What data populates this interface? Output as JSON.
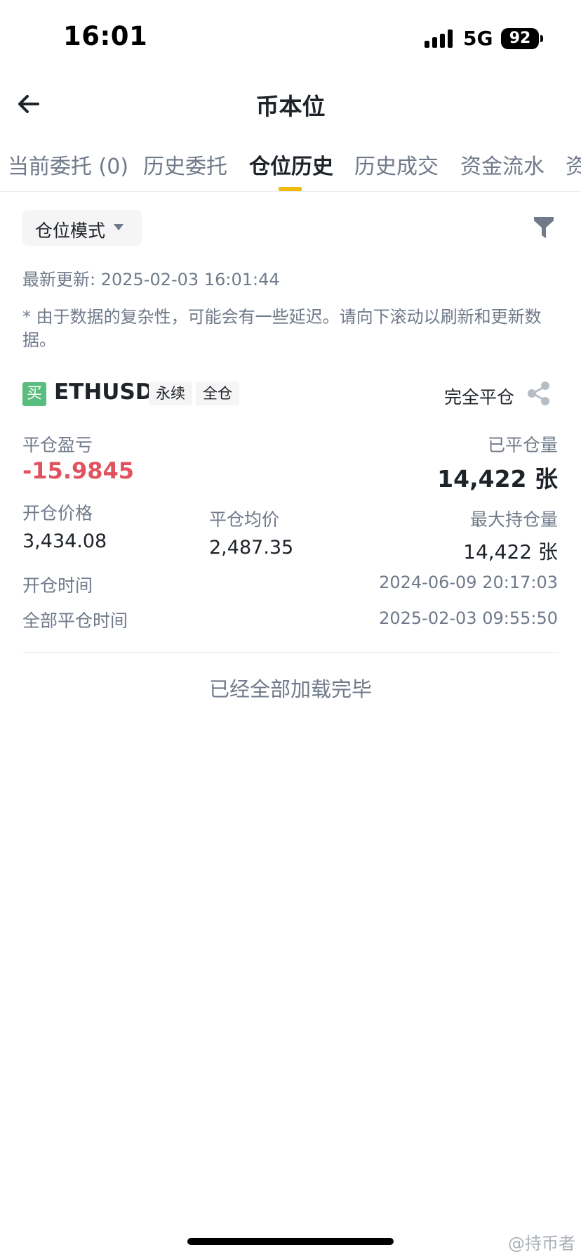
{
  "status_bar": {
    "time": "16:01",
    "network": "5G",
    "battery": "92"
  },
  "header": {
    "title": "币本位"
  },
  "tabs": [
    {
      "label": "当前委托 (0)",
      "active": false
    },
    {
      "label": "历史委托",
      "active": false
    },
    {
      "label": "仓位历史",
      "active": true
    },
    {
      "label": "历史成交",
      "active": false
    },
    {
      "label": "资金流水",
      "active": false
    },
    {
      "label": "资",
      "active": false
    }
  ],
  "colors": {
    "accent": "#f0b90b",
    "buy": "#58bd7d",
    "loss": "#e0535e"
  },
  "filters": {
    "mode_label": "仓位模式"
  },
  "update": {
    "text": "最新更新: 2025-02-03 16:01:44"
  },
  "disclaimer": "* 由于数据的复杂性，可能会有一些延迟。请向下滚动以刷新和更新数据。",
  "position": {
    "side_badge": "买",
    "symbol": "ETHUSD",
    "tag_contract": "永续",
    "tag_margin": "全仓",
    "close_status": "完全平仓",
    "pnl_label": "平仓盈亏",
    "pnl_value": "-15.9845",
    "closed_qty_label": "已平仓量",
    "closed_qty_value": "14,422 张",
    "open_price_label": "开仓价格",
    "open_price_value": "3,434.08",
    "avg_close_label": "平仓均价",
    "avg_close_value": "2,487.35",
    "max_pos_label": "最大持仓量",
    "max_pos_value": "14,422 张",
    "open_time_label": "开仓时间",
    "open_time_value": "2024-06-09 20:17:03",
    "close_time_label": "全部平仓时间",
    "close_time_value": "2025-02-03 09:55:50"
  },
  "footer": {
    "loaded_text": "已经全部加载完毕"
  },
  "watermark": "@持币者"
}
